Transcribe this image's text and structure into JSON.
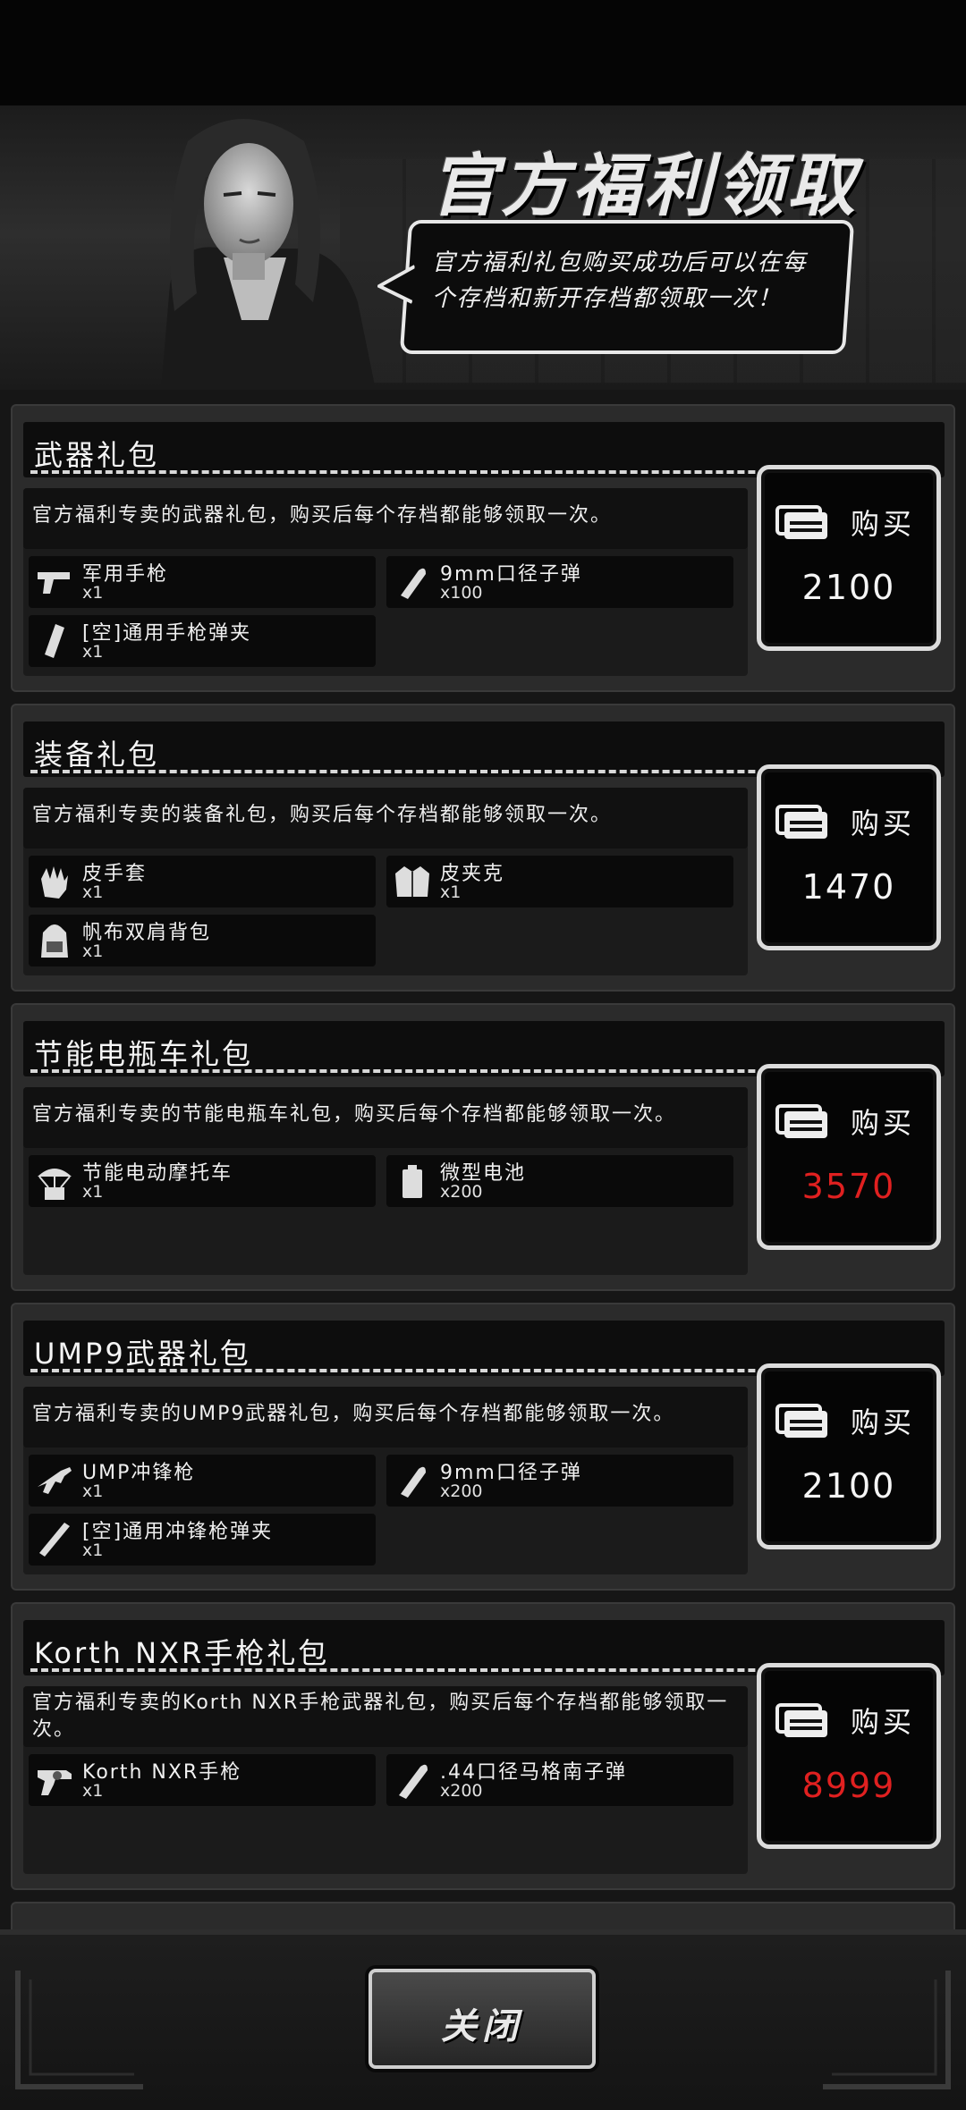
{
  "header": {
    "title": "官方福利领取",
    "bubble_text": "官方福利礼包购买成功后可以在每个存档和新开存档都领取一次！"
  },
  "buy_label": "购买",
  "packs": [
    {
      "title": "武器礼包",
      "description": "官方福利专卖的武器礼包，购买后每个存档都能够领取一次。",
      "items": [
        {
          "name": "军用手枪",
          "qty": "x1",
          "icon": "pistol-icon"
        },
        {
          "name": "9mm口径子弹",
          "qty": "x100",
          "icon": "bullet-icon"
        },
        {
          "name": "[空]通用手枪弹夹",
          "qty": "x1",
          "icon": "magazine-icon"
        }
      ],
      "price": "2100",
      "price_color": "#f5f5f5"
    },
    {
      "title": "装备礼包",
      "description": "官方福利专卖的装备礼包，购买后每个存档都能够领取一次。",
      "items": [
        {
          "name": "皮手套",
          "qty": "x1",
          "icon": "glove-icon"
        },
        {
          "name": "皮夹克",
          "qty": "x1",
          "icon": "jacket-icon"
        },
        {
          "name": "帆布双肩背包",
          "qty": "x1",
          "icon": "backpack-icon"
        }
      ],
      "price": "1470",
      "price_color": "#f5f5f5"
    },
    {
      "title": "节能电瓶车礼包",
      "description": "官方福利专卖的节能电瓶车礼包，购买后每个存档都能够领取一次。",
      "items": [
        {
          "name": "节能电动摩托车",
          "qty": "x1",
          "icon": "airdrop-icon"
        },
        {
          "name": "微型电池",
          "qty": "x200",
          "icon": "battery-icon"
        }
      ],
      "price": "3570",
      "price_color": "#e02020"
    },
    {
      "title": "UMP9武器礼包",
      "description": "官方福利专卖的UMP9武器礼包，购买后每个存档都能够领取一次。",
      "items": [
        {
          "name": "UMP冲锋枪",
          "qty": "x1",
          "icon": "smg-icon"
        },
        {
          "name": "9mm口径子弹",
          "qty": "x200",
          "icon": "bullet-icon"
        },
        {
          "name": "[空]通用冲锋枪弹夹",
          "qty": "x1",
          "icon": "magazine-icon"
        }
      ],
      "price": "2100",
      "price_color": "#f5f5f5"
    },
    {
      "title": "Korth NXR手枪礼包",
      "description": "官方福利专卖的Korth NXR手枪武器礼包，购买后每个存档都能够领取一次。",
      "items": [
        {
          "name": "Korth NXR手枪",
          "qty": "x1",
          "icon": "revolver-icon"
        },
        {
          "name": ".44口径马格南子弹",
          "qty": "x200",
          "icon": "bullet-icon"
        }
      ],
      "price": "8999",
      "price_color": "#e02020"
    }
  ],
  "footer": {
    "close_label": "关闭"
  }
}
